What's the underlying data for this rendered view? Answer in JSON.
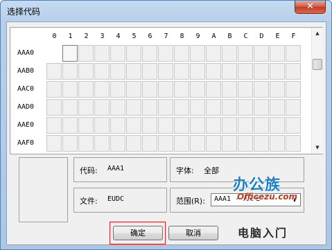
{
  "window": {
    "title": "选择代码",
    "close_symbol": "✕"
  },
  "grid": {
    "columns": [
      "0",
      "1",
      "2",
      "3",
      "4",
      "5",
      "6",
      "7",
      "8",
      "9",
      "A",
      "B",
      "C",
      "D",
      "E",
      "F"
    ],
    "rows": [
      "AAA0",
      "AAB0",
      "AAC0",
      "AAD0",
      "AAE0",
      "AAF0"
    ],
    "selected_cell": "AAA1",
    "scroll_up_symbol": "▲",
    "scroll_down_symbol": "▼"
  },
  "info": {
    "code_label": "代码:",
    "code_value": "AAA1",
    "font_label": "字体:",
    "font_value": "全部",
    "file_label": "文件:",
    "file_value": "EUDC",
    "range_label": "范围(R):",
    "range_value": "AAA1 - AAFE",
    "range_arrow": "▼"
  },
  "buttons": {
    "ok_label": "确定",
    "cancel_label": "取消"
  },
  "watermark": {
    "brand_cn": "办公族",
    "brand_en": "Officezu.com",
    "tagline": "电脑入门"
  }
}
